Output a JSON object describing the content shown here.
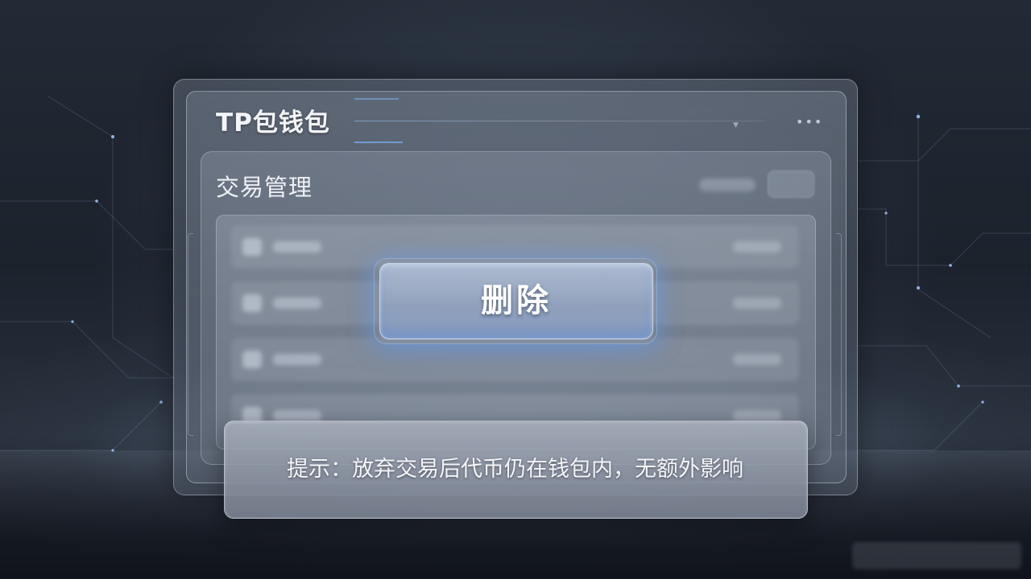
{
  "wallet": {
    "title": "TP包钱包"
  },
  "section": {
    "title": "交易管理"
  },
  "actions": {
    "delete_label": "删除"
  },
  "tip": {
    "text": "提示：放弃交易后代币仍在钱包内，无额外影响"
  },
  "icons": {
    "more": "more-horizontal-icon"
  },
  "colors": {
    "accent_glow": "#6ea0e6",
    "background": "#1b212b",
    "text": "#f2f4f8"
  }
}
